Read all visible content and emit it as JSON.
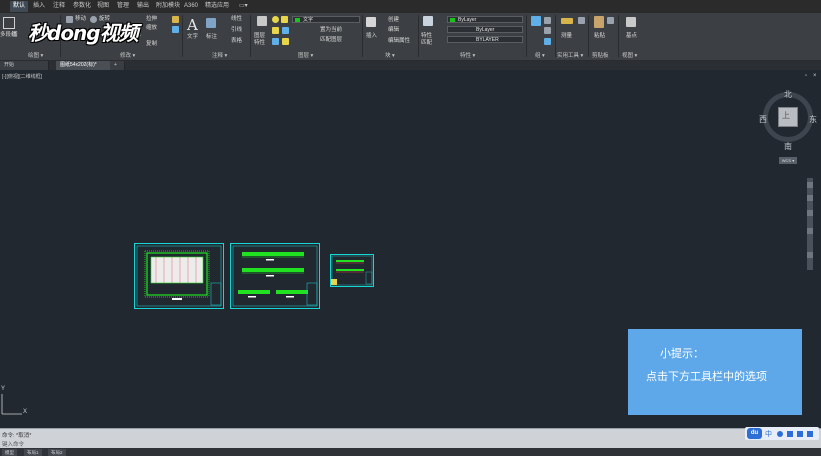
{
  "menu": {
    "tabs": [
      "默认",
      "插入",
      "注释",
      "参数化",
      "视图",
      "管理",
      "输出",
      "附加模块",
      "A360",
      "精选应用",
      "▭▾"
    ]
  },
  "logo": {
    "text": "秒dong视频"
  },
  "ribbon": {
    "draw": {
      "items": [
        "多段线",
        "圆",
        "圆弧"
      ],
      "label": "绘图 ▾"
    },
    "modify": {
      "items": [
        "移动",
        "旋转",
        "复制",
        "镜像",
        "拉伸",
        "缩放"
      ],
      "label": "修改 ▾"
    },
    "annotation": {
      "items": [
        "文字",
        "标注",
        "线性",
        "引线",
        "表格"
      ],
      "label": "注释 ▾"
    },
    "layers": {
      "items": [
        "图层特性",
        "置为当前",
        "匹配图层"
      ],
      "layer_value": "文字",
      "label": "图层 ▾"
    },
    "block": {
      "items": [
        "插入",
        "创建",
        "编辑",
        "编辑属性"
      ],
      "label": "块 ▾"
    },
    "properties": {
      "items": [
        "特性匹配"
      ],
      "color_value": "ByLayer",
      "linetype_value": "ByLayer",
      "lineweight_value": "BYLAYER",
      "label": "特性 ▾"
    },
    "groups": {
      "label": "组 ▾"
    },
    "utilities": {
      "items": [
        "测量"
      ],
      "label": "实用工具 ▾"
    },
    "clipboard": {
      "items": [
        "粘贴"
      ],
      "label": "剪贴板"
    },
    "view": {
      "items": [
        "基点"
      ],
      "label": "视图 ▾"
    }
  },
  "doctabs": [
    "开始",
    "图纸54x202(标)*",
    "+"
  ],
  "viewport_label": "[-][俯视][二维线框]",
  "viewcube": {
    "north": "北",
    "south": "南",
    "east": "东",
    "west": "西",
    "top": "上",
    "wcs": "WCS ▾"
  },
  "hint": {
    "title": "小提示：",
    "body": "点击下方工具栏中的选项"
  },
  "ucs": {
    "y": "Y",
    "x": "X"
  },
  "command": {
    "history": "命令: *取消*",
    "prompt": "键入命令"
  },
  "layout_tabs": [
    "模型",
    "布局1",
    "布局2"
  ],
  "ime": {
    "badge": "du",
    "lang": "中"
  },
  "colors": {
    "canvas": "#212830",
    "sheet_frame": "#19d6d6",
    "drawing_lines": "#21e221",
    "hint_bg": "#5ea8ea"
  }
}
